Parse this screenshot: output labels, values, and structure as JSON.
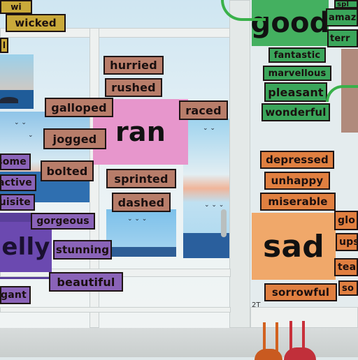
{
  "scene": {
    "brown_words": [
      "hurried",
      "rushed",
      "galloped",
      "raced",
      "jogged",
      "bolted",
      "sprinted",
      "dashed"
    ],
    "purple_words": [
      "some",
      "active",
      "lovely",
      "exquisite",
      "gorgeous",
      "stunning",
      "beautiful",
      "elegant"
    ],
    "green_words": [
      "fantastic",
      "marvellous",
      "pleasant",
      "wonderful",
      "amaze",
      "terr",
      "spl"
    ],
    "orange_words": [
      "depressed",
      "unhappy",
      "miserable",
      "sorrowful",
      "glo",
      "ups",
      "tea",
      "so"
    ],
    "yellow_words": [
      "wicked",
      "wi",
      "l"
    ],
    "headline_ran": "ran",
    "headline_good": "good",
    "headline_sad": "sad",
    "headline_elly": "elly",
    "sign_fragment": "2T",
    "colors": {
      "brown": "#b87d6a",
      "purple": "#8a63b8",
      "green": "#3aa55a",
      "orange": "#e07f40",
      "pink": "#e796cc",
      "peach": "#f0a86a"
    }
  }
}
